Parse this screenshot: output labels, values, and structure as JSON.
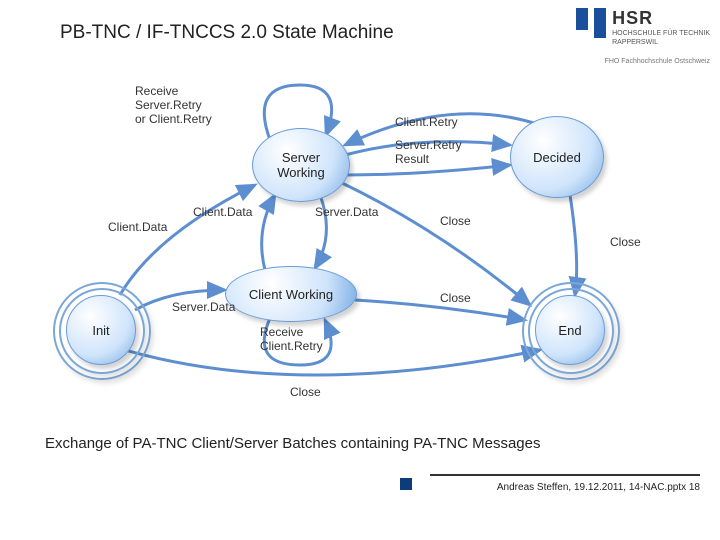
{
  "title": "PB-TNC / IF-TNCCS 2.0 State Machine",
  "logo": {
    "name": "HSR",
    "sub1": "HOCHSCHULE FÜR TECHNIK",
    "sub2": "RAPPERSWIL",
    "fho": "FHO Fachhochschule Ostschweiz"
  },
  "states": {
    "init": "Init",
    "server_working": "Server\nWorking",
    "client_working": "Client Working",
    "decided": "Decided",
    "end": "End"
  },
  "transitions": {
    "receive_retry": "Receive\nServer.Retry\nor Client.Retry",
    "client_retry": "Client.Retry",
    "server_retry_result": "Server.Retry\nResult",
    "client_data_left": "Client.Data",
    "client_data_mid": "Client.Data",
    "server_data_mid": "Server.Data",
    "server_data_left": "Server.Data",
    "receive_client_retry": "Receive\nClient.Retry",
    "close_mid": "Close",
    "close_decided": "Close",
    "close_clientworking": "Close",
    "close_bottom": "Close"
  },
  "caption": "Exchange of  PA-TNC Client/Server Batches containing PA-TNC Messages",
  "footer": "Andreas Steffen, 19.12.2011, 14-NAC.pptx 18"
}
